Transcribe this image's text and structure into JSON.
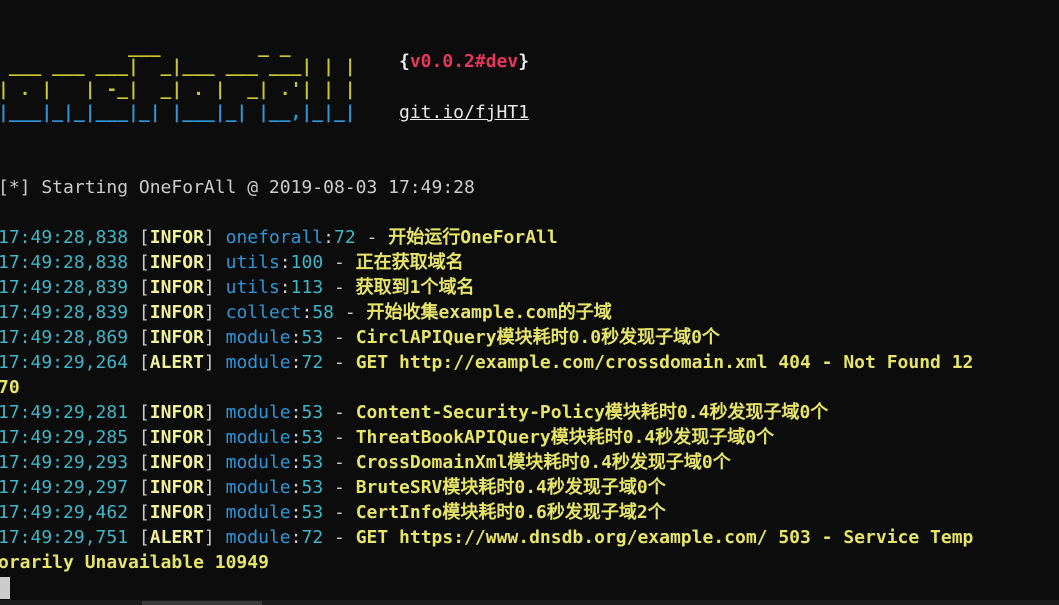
{
  "banner": {
    "rows": [
      {
        "y": "            ___         _ _ ",
        "b": ""
      },
      {
        "y": " ___ ___ ___|  _|___ ___ ___| | |",
        "b": ""
      },
      {
        "y": "| . |   | -_|  _| . |  _| .'| | |",
        "b": ""
      },
      {
        "y": "",
        "b": "|___|_|_|___|_| |___|_| |__,|_|_|"
      }
    ],
    "version_open": "{",
    "version": "v0.0.2#dev",
    "version_close": "}",
    "link": "git.io/fjHT1"
  },
  "start_line": "[*] Starting OneForAll @ 2019-08-03 17:49:28",
  "log": [
    {
      "ts": "17:49:28,838",
      "level": "INFOR",
      "module": "oneforall",
      "line": "72",
      "msg": "开始运行OneForAll"
    },
    {
      "ts": "17:49:28,838",
      "level": "INFOR",
      "module": "utils",
      "line": "100",
      "msg": "正在获取域名"
    },
    {
      "ts": "17:49:28,839",
      "level": "INFOR",
      "module": "utils",
      "line": "113",
      "msg": "获取到1个域名"
    },
    {
      "ts": "17:49:28,839",
      "level": "INFOR",
      "module": "collect",
      "line": "58",
      "msg": "开始收集example.com的子域"
    },
    {
      "ts": "17:49:28,869",
      "level": "INFOR",
      "module": "module",
      "line": "53",
      "msg": "CirclAPIQuery模块耗时0.0秒发现子域0个"
    },
    {
      "ts": "17:49:29,264",
      "level": "ALERT",
      "module": "module",
      "line": "72",
      "msg": "GET http://example.com/crossdomain.xml 404 - Not Found 12"
    },
    {
      "ts": "",
      "level": "",
      "module": "",
      "line": "",
      "msg": "70"
    },
    {
      "ts": "17:49:29,281",
      "level": "INFOR",
      "module": "module",
      "line": "53",
      "msg": "Content-Security-Policy模块耗时0.4秒发现子域0个"
    },
    {
      "ts": "17:49:29,285",
      "level": "INFOR",
      "module": "module",
      "line": "53",
      "msg": "ThreatBookAPIQuery模块耗时0.4秒发现子域0个"
    },
    {
      "ts": "17:49:29,293",
      "level": "INFOR",
      "module": "module",
      "line": "53",
      "msg": "CrossDomainXml模块耗时0.4秒发现子域0个"
    },
    {
      "ts": "17:49:29,297",
      "level": "INFOR",
      "module": "module",
      "line": "53",
      "msg": "BruteSRV模块耗时0.4秒发现子域0个"
    },
    {
      "ts": "17:49:29,462",
      "level": "INFOR",
      "module": "module",
      "line": "53",
      "msg": "CertInfo模块耗时0.6秒发现子域2个"
    },
    {
      "ts": "17:49:29,751",
      "level": "ALERT",
      "module": "module",
      "line": "72",
      "msg": "GET https://www.dnsdb.org/example.com/ 503 - Service Temp"
    },
    {
      "ts": "",
      "level": "",
      "module": "",
      "line": "",
      "msg": "orarily Unavailable 10949"
    }
  ],
  "colors": {
    "background": "#0c0c0c",
    "timestamp": "#3fb7c8",
    "module": "#2f97d9",
    "message": "#e6e56a",
    "version": "#e7365b"
  }
}
